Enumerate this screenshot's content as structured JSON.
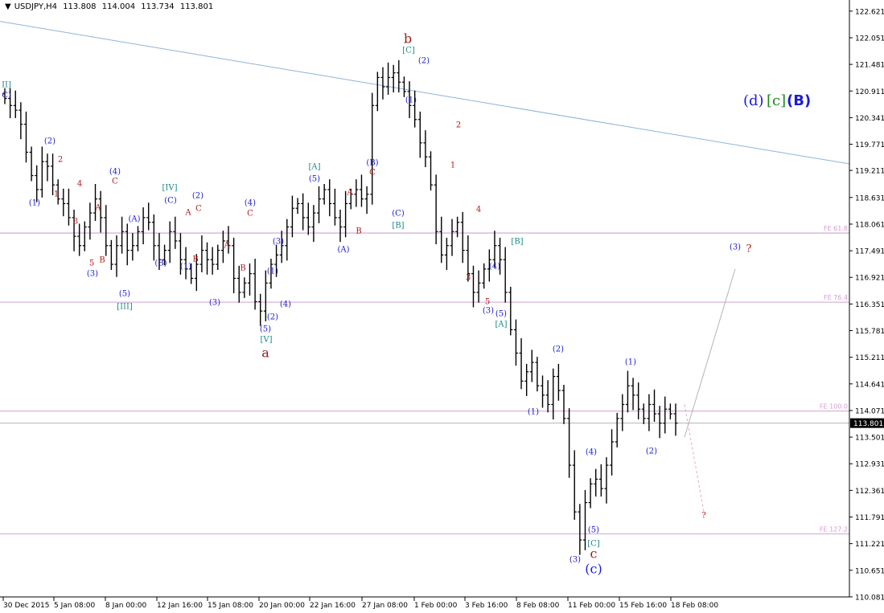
{
  "header": {
    "symbol": "USDJPY,H4",
    "open": "113.808",
    "high": "114.004",
    "low": "113.734",
    "close": "113.801"
  },
  "colors": {
    "candle": "#000000",
    "trendline": "#8fb3d9",
    "fib_line": "#d8b4d8",
    "fib_label": "#d29bd2",
    "price_line": "#b4b4b4",
    "projection": "#b4b4b4",
    "projection_dashed": "#e4a6c4",
    "label_blue": "#1b1bd6",
    "label_red": "#b01c1c",
    "label_teal": "#1a8a8a",
    "label_green": "#1b8a1b",
    "label_darkred": "#9b1c1c"
  },
  "chart_data": {
    "type": "ohlc",
    "symbol": "USDJPY",
    "timeframe": "H4",
    "ylim": [
      110.08,
      122.79
    ],
    "y_ticks": [
      "122.621",
      "122.051",
      "121.481",
      "120.911",
      "120.341",
      "119.771",
      "119.211",
      "118.631",
      "118.061",
      "117.491",
      "116.921",
      "116.351",
      "115.781",
      "115.211",
      "114.641",
      "114.071",
      "113.501",
      "112.931",
      "112.361",
      "111.791",
      "111.221",
      "110.651",
      "110.081"
    ],
    "current_price": "113.801",
    "x_labels": [
      "30 Dec 2015",
      "5 Jan 08:00",
      "8 Jan 00:00",
      "12 Jan 16:00",
      "15 Jan 08:00",
      "20 Jan 00:00",
      "22 Jan 16:00",
      "27 Jan 08:00",
      "1 Feb 00:00",
      "3 Feb 16:00",
      "8 Feb 08:00",
      "11 Feb 00:00",
      "15 Feb 16:00",
      "18 Feb 08:00"
    ],
    "closes": [
      120.75,
      120.6,
      120.5,
      120.2,
      119.6,
      119.1,
      118.8,
      119.4,
      119.3,
      118.9,
      118.6,
      118.5,
      118.2,
      117.8,
      117.6,
      118.0,
      118.3,
      118.6,
      118.2,
      117.6,
      117.2,
      117.6,
      117.9,
      117.5,
      117.6,
      117.9,
      118.2,
      118.1,
      117.6,
      117.3,
      117.5,
      117.9,
      117.7,
      117.3,
      117.1,
      116.9,
      117.2,
      117.5,
      117.3,
      117.2,
      117.5,
      117.7,
      117.6,
      116.9,
      116.6,
      116.8,
      117.0,
      116.4,
      116.2,
      116.8,
      117.2,
      117.4,
      117.6,
      118.0,
      118.4,
      118.5,
      118.2,
      118.0,
      118.3,
      118.6,
      118.8,
      118.5,
      118.2,
      118.0,
      118.5,
      118.7,
      118.8,
      118.6,
      118.7,
      120.6,
      121.2,
      121.0,
      121.2,
      121.3,
      121.1,
      120.9,
      120.6,
      120.3,
      119.8,
      119.5,
      118.9,
      117.9,
      117.4,
      117.6,
      117.9,
      118.1,
      117.5,
      117.0,
      116.6,
      116.8,
      117.1,
      117.3,
      117.6,
      117.3,
      116.6,
      115.8,
      115.3,
      114.7,
      114.9,
      115.1,
      114.6,
      114.4,
      114.2,
      114.8,
      114.5,
      113.9,
      112.9,
      111.9,
      111.3,
      112.1,
      112.5,
      112.6,
      112.4,
      112.9,
      113.4,
      113.9,
      114.2,
      114.6,
      114.4,
      114.1,
      113.9,
      114.2,
      114.0,
      113.8,
      114.1,
      114.0,
      113.8
    ],
    "lines": [
      {
        "kind": "trend",
        "from": [
          "30 Dec 2015",
          122.4
        ],
        "to": [
          "end",
          119.35
        ]
      },
      {
        "kind": "fib",
        "label": "FE 61.8",
        "y": 117.87
      },
      {
        "kind": "fib",
        "label": "FE 76.4",
        "y": 116.39
      },
      {
        "kind": "fib",
        "label": "FE 100.0",
        "y": 114.06
      },
      {
        "kind": "fib",
        "label": "FE 127.2",
        "y": 111.43
      },
      {
        "kind": "price",
        "y": 113.801
      }
    ],
    "annotations": [
      {
        "text": "II]",
        "color": "teal",
        "at": [
          8,
          105
        ]
      },
      {
        "text": "C)",
        "color": "blue",
        "at": [
          8,
          118
        ]
      },
      {
        "text": "(2)",
        "color": "blue",
        "at": [
          62,
          175
        ]
      },
      {
        "text": "2",
        "color": "red",
        "at": [
          75,
          198
        ]
      },
      {
        "text": "1",
        "color": "red",
        "at": [
          70,
          241
        ]
      },
      {
        "text": "(1)",
        "color": "blue",
        "at": [
          43,
          252
        ]
      },
      {
        "text": "4",
        "color": "red",
        "at": [
          99,
          228
        ]
      },
      {
        "text": "3",
        "color": "red",
        "at": [
          94,
          275
        ]
      },
      {
        "text": "(4)",
        "color": "blue",
        "at": [
          143,
          213
        ]
      },
      {
        "text": "C",
        "color": "red",
        "at": [
          143,
          225
        ]
      },
      {
        "text": "A",
        "color": "red",
        "at": [
          122,
          258
        ]
      },
      {
        "text": "B",
        "color": "red",
        "at": [
          127,
          323
        ]
      },
      {
        "text": "5",
        "color": "red",
        "at": [
          114,
          327
        ]
      },
      {
        "text": "(3)",
        "color": "blue",
        "at": [
          115,
          340
        ]
      },
      {
        "text": "(A)",
        "color": "blue",
        "at": [
          167,
          272
        ]
      },
      {
        "text": "(B)",
        "color": "blue",
        "at": [
          200,
          327
        ]
      },
      {
        "text": "[IV]",
        "color": "teal",
        "at": [
          211,
          233
        ]
      },
      {
        "text": "(C)",
        "color": "blue",
        "at": [
          212,
          249
        ]
      },
      {
        "text": "(5)",
        "color": "blue",
        "at": [
          155,
          365
        ]
      },
      {
        "text": "[III]",
        "color": "teal",
        "at": [
          155,
          381
        ]
      },
      {
        "text": "(2)",
        "color": "blue",
        "at": [
          246,
          243
        ]
      },
      {
        "text": "A",
        "color": "red",
        "at": [
          234,
          264
        ]
      },
      {
        "text": "C",
        "color": "red",
        "at": [
          247,
          259
        ]
      },
      {
        "text": "B",
        "color": "red",
        "at": [
          243,
          322
        ]
      },
      {
        "text": "(1)",
        "color": "blue",
        "at": [
          231,
          331
        ]
      },
      {
        "text": "A",
        "color": "red",
        "at": [
          282,
          305
        ]
      },
      {
        "text": "B",
        "color": "red",
        "at": [
          302,
          333
        ]
      },
      {
        "text": "(4)",
        "color": "blue",
        "at": [
          311,
          252
        ]
      },
      {
        "text": "C",
        "color": "red",
        "at": [
          311,
          265
        ]
      },
      {
        "text": "(3)",
        "color": "blue",
        "at": [
          267,
          376
        ]
      },
      {
        "text": "(3)",
        "color": "blue",
        "at": [
          346,
          300
        ]
      },
      {
        "text": "(1)",
        "color": "blue",
        "at": [
          339,
          337
        ]
      },
      {
        "text": "(2)",
        "color": "blue",
        "at": [
          339,
          394
        ]
      },
      {
        "text": "(4)",
        "color": "blue",
        "at": [
          355,
          378
        ]
      },
      {
        "text": "(5)",
        "color": "blue",
        "at": [
          330,
          409
        ]
      },
      {
        "text": "[V]",
        "color": "teal",
        "at": [
          331,
          422
        ]
      },
      {
        "text": "a",
        "color": "darkred",
        "at": [
          330,
          439
        ],
        "size": 16
      },
      {
        "text": "[A]",
        "color": "teal",
        "at": [
          391,
          207
        ]
      },
      {
        "text": "(5)",
        "color": "blue",
        "at": [
          391,
          222
        ]
      },
      {
        "text": "A",
        "color": "red",
        "at": [
          435,
          239
        ]
      },
      {
        "text": "B",
        "color": "red",
        "at": [
          446,
          287
        ]
      },
      {
        "text": "(A)",
        "color": "blue",
        "at": [
          427,
          310
        ]
      },
      {
        "text": "(B)",
        "color": "blue",
        "at": [
          463,
          202
        ]
      },
      {
        "text": "C",
        "color": "red",
        "at": [
          463,
          214
        ]
      },
      {
        "text": "(C)",
        "color": "blue",
        "at": [
          495,
          265
        ]
      },
      {
        "text": "[B]",
        "color": "teal",
        "at": [
          495,
          280
        ]
      },
      {
        "text": "b",
        "color": "darkred",
        "at": [
          507,
          48
        ],
        "size": 16
      },
      {
        "text": "[C]",
        "color": "teal",
        "at": [
          508,
          62
        ]
      },
      {
        "text": "(2)",
        "color": "blue",
        "at": [
          527,
          75
        ]
      },
      {
        "text": "(1)",
        "color": "blue",
        "at": [
          511,
          124
        ]
      },
      {
        "text": "2",
        "color": "red",
        "at": [
          570,
          155
        ]
      },
      {
        "text": "1",
        "color": "red",
        "at": [
          563,
          205
        ]
      },
      {
        "text": "4",
        "color": "red",
        "at": [
          595,
          260
        ]
      },
      {
        "text": "3",
        "color": "red",
        "at": [
          582,
          345
        ]
      },
      {
        "text": "[B]",
        "color": "teal",
        "at": [
          643,
          300
        ]
      },
      {
        "text": "(4)",
        "color": "blue",
        "at": [
          615,
          331
        ]
      },
      {
        "text": "5",
        "color": "red",
        "at": [
          606,
          375
        ]
      },
      {
        "text": "(3)",
        "color": "blue",
        "at": [
          607,
          386
        ]
      },
      {
        "text": "(5)",
        "color": "blue",
        "at": [
          623,
          390
        ]
      },
      {
        "text": "[A]",
        "color": "teal",
        "at": [
          623,
          403
        ]
      },
      {
        "text": "(2)",
        "color": "blue",
        "at": [
          694,
          434
        ]
      },
      {
        "text": "(1)",
        "color": "blue",
        "at": [
          663,
          512
        ]
      },
      {
        "text": "(4)",
        "color": "blue",
        "at": [
          735,
          562
        ]
      },
      {
        "text": "(5)",
        "color": "blue",
        "at": [
          738,
          659
        ]
      },
      {
        "text": "[C]",
        "color": "teal",
        "at": [
          738,
          676
        ]
      },
      {
        "text": "c",
        "color": "darkred",
        "at": [
          738,
          689
        ],
        "size": 16
      },
      {
        "text": "(3)",
        "color": "blue",
        "at": [
          715,
          696
        ]
      },
      {
        "text": "(c)",
        "color": "blue",
        "at": [
          738,
          708
        ],
        "size": 16
      },
      {
        "text": "(1)",
        "color": "blue",
        "at": [
          784,
          450
        ]
      },
      {
        "text": "(2)",
        "color": "blue",
        "at": [
          810,
          561
        ]
      },
      {
        "text": "(3)",
        "color": "blue",
        "at": [
          914,
          307
        ]
      },
      {
        "text": "?",
        "color": "red",
        "at": [
          931,
          309
        ],
        "size": 13
      },
      {
        "text": "?",
        "color": "red",
        "at": [
          875,
          641
        ]
      }
    ],
    "legend_title": {
      "d": "(d)",
      "c": "[c]",
      "B": "(B)"
    }
  }
}
